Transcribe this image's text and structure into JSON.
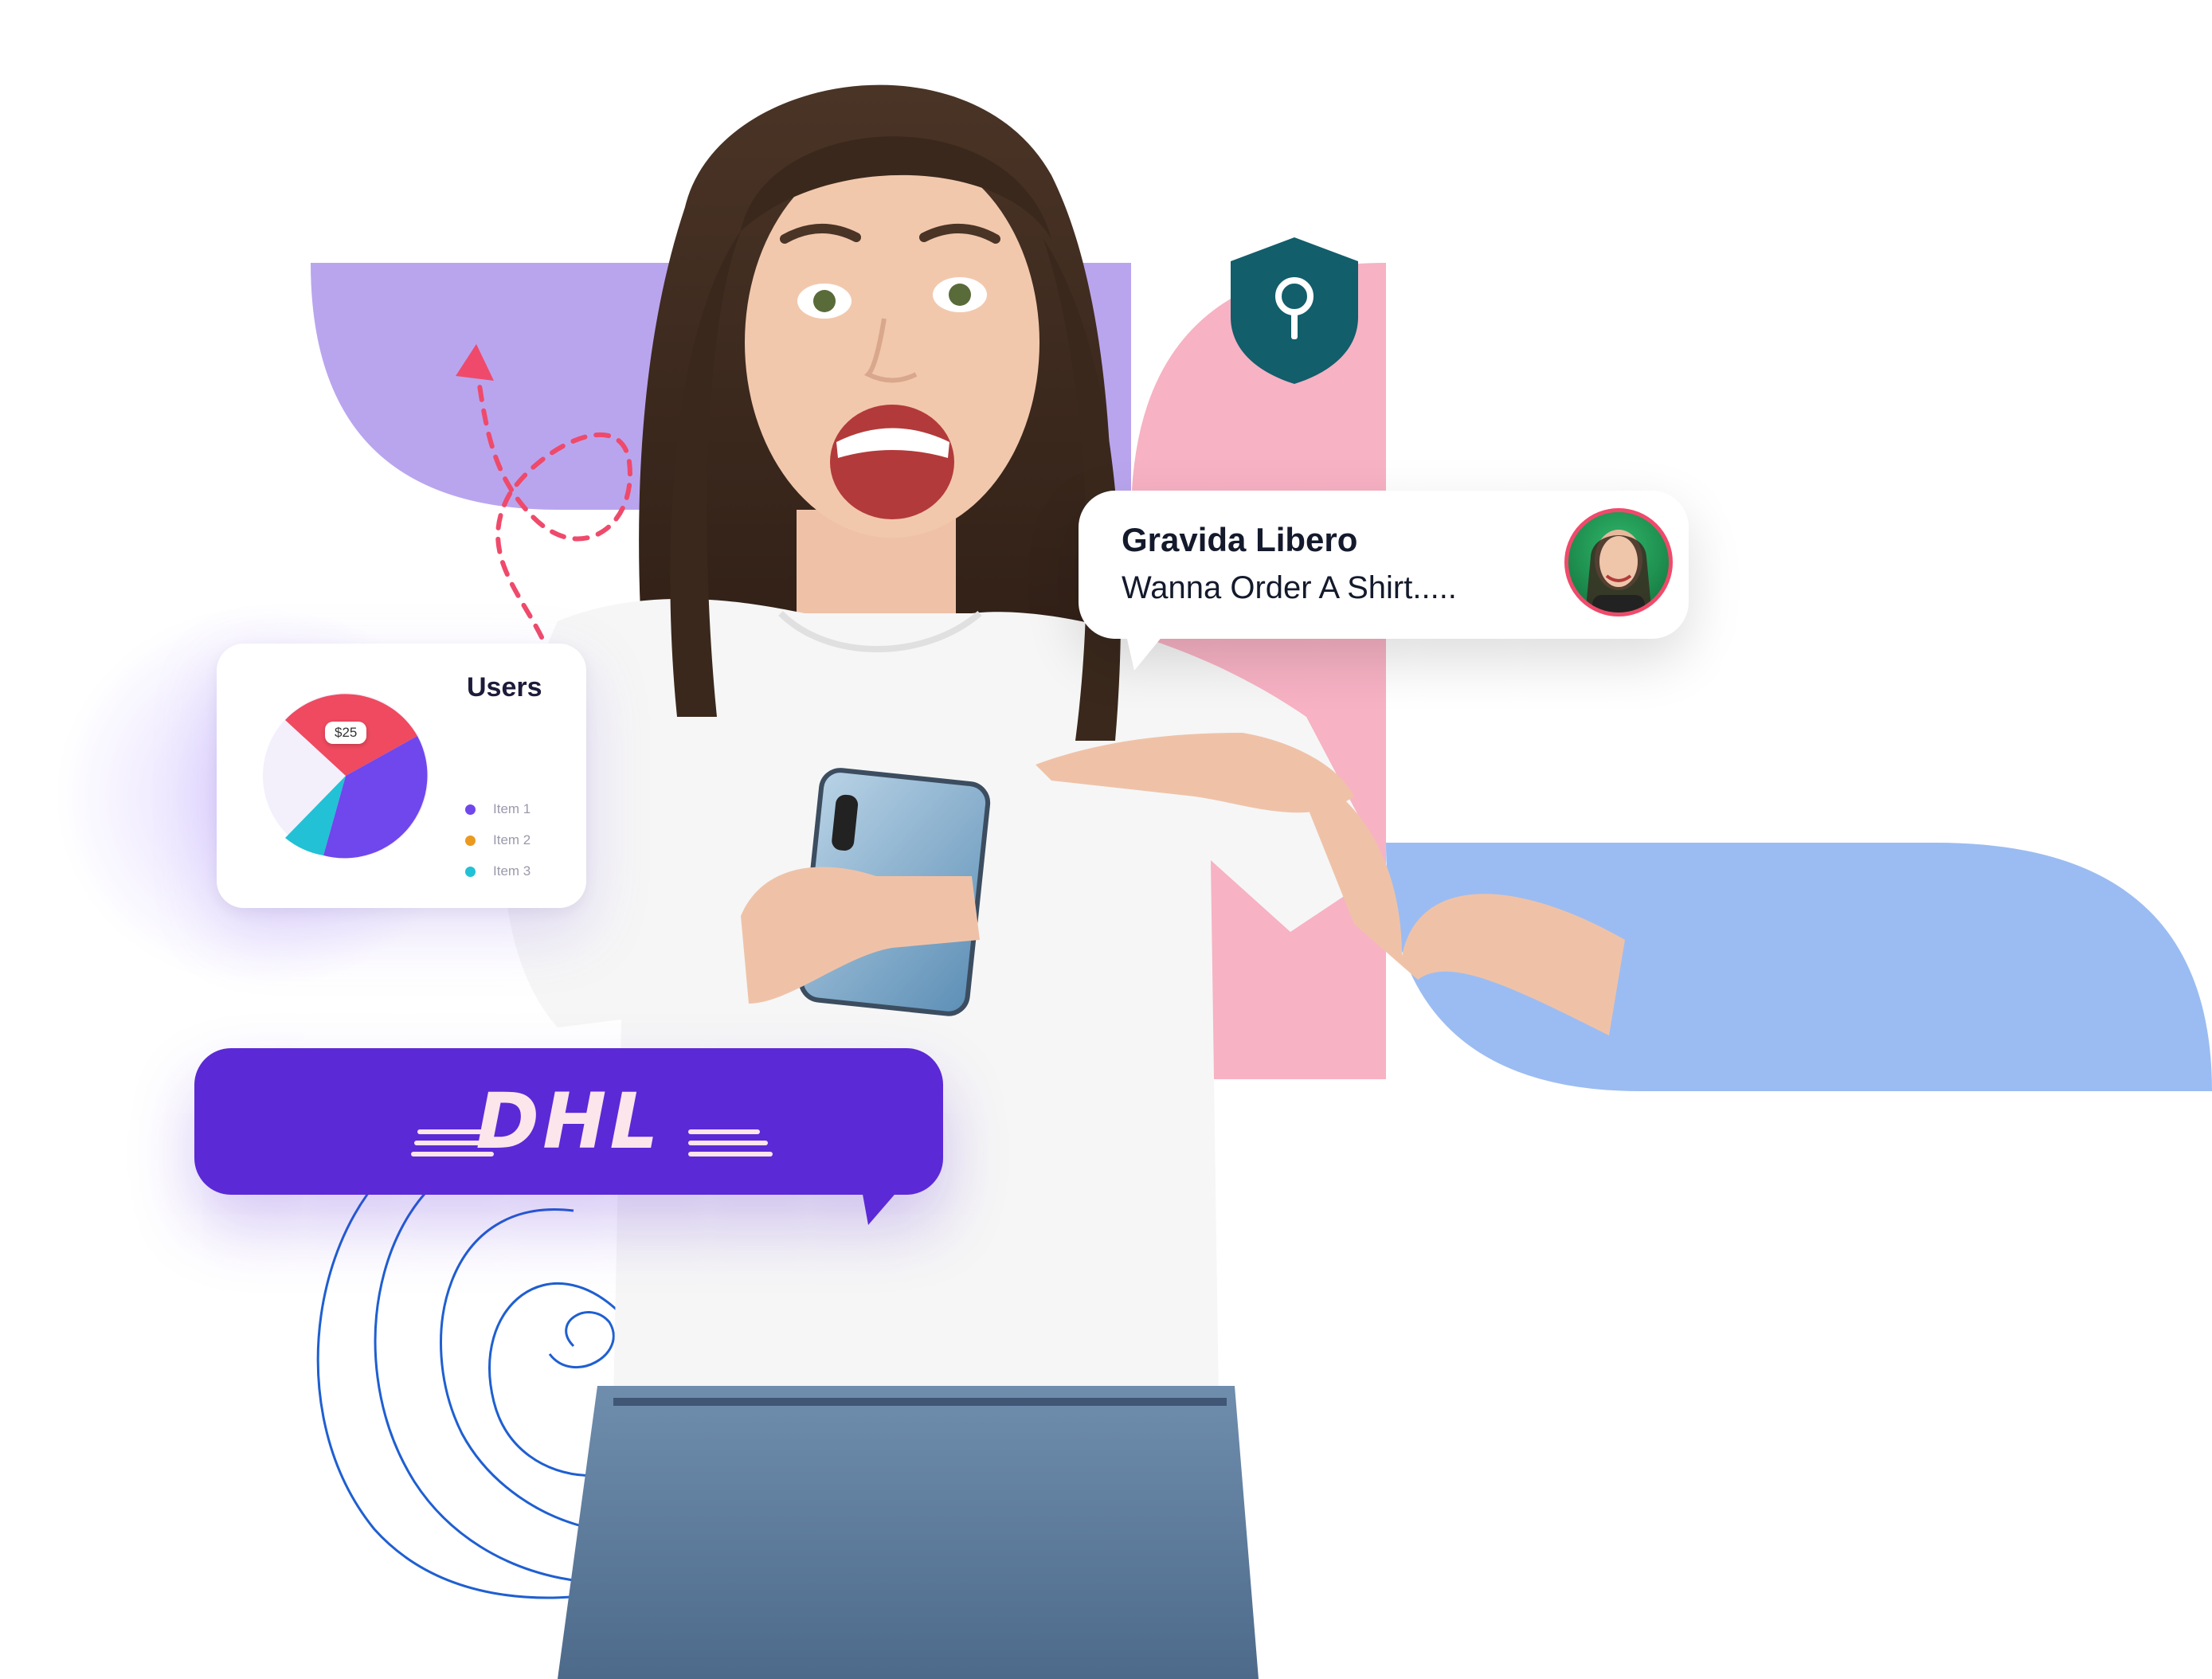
{
  "users_card": {
    "title": "Users",
    "price_tag": "$25",
    "legend": [
      {
        "label": "Item 1",
        "color": "#6f47ec"
      },
      {
        "label": "Item 2",
        "color": "#e99a1f"
      },
      {
        "label": "Item 3",
        "color": "#22c1d6"
      }
    ]
  },
  "message": {
    "sender": "Gravida Libero",
    "text": "Wanna Order A Shirt....."
  },
  "dhl_banner": {
    "logo_text": "DHL"
  },
  "colors": {
    "purple_shape": "#b9a5ee",
    "pink_shape": "#f7b2c4",
    "blue_shape": "#9bbcf2",
    "shield": "#125e6b",
    "banner": "#5c29d6",
    "arrow": "#ef4a6b",
    "spiral": "#1f5fd1"
  },
  "icons": [
    "key-shield-icon",
    "dashed-arrow-icon",
    "spiral-decoration"
  ]
}
